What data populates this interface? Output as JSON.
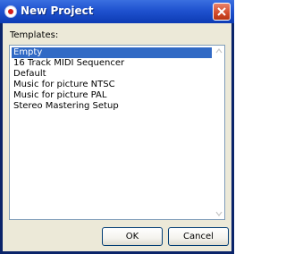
{
  "window": {
    "title": "New Project"
  },
  "templates_label": "Templates:",
  "templates": [
    {
      "label": "Empty",
      "selected": true
    },
    {
      "label": "16 Track MIDI Sequencer",
      "selected": false
    },
    {
      "label": "Default",
      "selected": false
    },
    {
      "label": "Music for picture NTSC",
      "selected": false
    },
    {
      "label": "Music for picture PAL",
      "selected": false
    },
    {
      "label": "Stereo Mastering Setup",
      "selected": false
    }
  ],
  "buttons": {
    "ok": "OK",
    "cancel": "Cancel"
  },
  "icons": {
    "app": "app-logo-icon",
    "close": "close-icon",
    "scroll_up": "scroll-up-arrow-icon",
    "scroll_down": "scroll-down-arrow-icon"
  },
  "colors": {
    "titlebar": "#1f52cf",
    "selection": "#316ac5",
    "dialog_bg": "#ece9d8",
    "close": "#d24a2a"
  }
}
